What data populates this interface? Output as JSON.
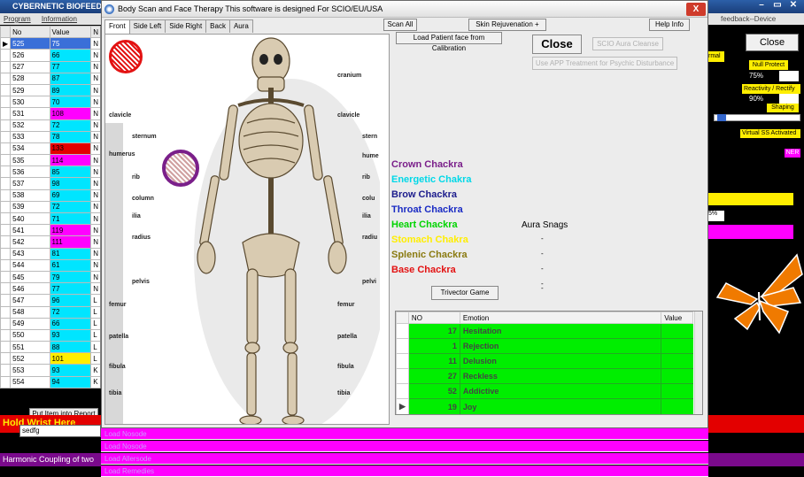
{
  "background_app": {
    "title": "CYBERNETIC BIOFEEDBA",
    "menu": [
      "Program",
      "Information",
      "A"
    ],
    "table_headers": [
      "No",
      "Value",
      "N"
    ],
    "rows": [
      {
        "no": "525",
        "value": "75",
        "flag": "N",
        "color": "#3a6fd8",
        "sel": true
      },
      {
        "no": "526",
        "value": "66",
        "flag": "N",
        "color": "#00e5ff"
      },
      {
        "no": "527",
        "value": "77",
        "flag": "N",
        "color": "#00e5ff"
      },
      {
        "no": "528",
        "value": "87",
        "flag": "N",
        "color": "#00e5ff"
      },
      {
        "no": "529",
        "value": "89",
        "flag": "N",
        "color": "#00e5ff"
      },
      {
        "no": "530",
        "value": "70",
        "flag": "N",
        "color": "#00e5ff"
      },
      {
        "no": "531",
        "value": "108",
        "flag": "N",
        "color": "#ff00ff"
      },
      {
        "no": "532",
        "value": "72",
        "flag": "N",
        "color": "#00e5ff"
      },
      {
        "no": "533",
        "value": "78",
        "flag": "N",
        "color": "#00e5ff"
      },
      {
        "no": "534",
        "value": "133",
        "flag": "N",
        "color": "#e30000"
      },
      {
        "no": "535",
        "value": "114",
        "flag": "N",
        "color": "#ff00ff"
      },
      {
        "no": "536",
        "value": "85",
        "flag": "N",
        "color": "#00e5ff"
      },
      {
        "no": "537",
        "value": "98",
        "flag": "N",
        "color": "#00e5ff"
      },
      {
        "no": "538",
        "value": "69",
        "flag": "N",
        "color": "#00e5ff"
      },
      {
        "no": "539",
        "value": "72",
        "flag": "N",
        "color": "#00e5ff"
      },
      {
        "no": "540",
        "value": "71",
        "flag": "N",
        "color": "#00e5ff"
      },
      {
        "no": "541",
        "value": "119",
        "flag": "N",
        "color": "#ff00ff"
      },
      {
        "no": "542",
        "value": "111",
        "flag": "N",
        "color": "#ff00ff"
      },
      {
        "no": "543",
        "value": "81",
        "flag": "N",
        "color": "#00e5ff"
      },
      {
        "no": "544",
        "value": "61",
        "flag": "N",
        "color": "#00e5ff"
      },
      {
        "no": "545",
        "value": "79",
        "flag": "N",
        "color": "#00e5ff"
      },
      {
        "no": "546",
        "value": "77",
        "flag": "N",
        "color": "#00e5ff"
      },
      {
        "no": "547",
        "value": "96",
        "flag": "L",
        "color": "#00e5ff"
      },
      {
        "no": "548",
        "value": "72",
        "flag": "L",
        "color": "#00e5ff"
      },
      {
        "no": "549",
        "value": "66",
        "flag": "L",
        "color": "#00e5ff"
      },
      {
        "no": "550",
        "value": "93",
        "flag": "L",
        "color": "#00e5ff"
      },
      {
        "no": "551",
        "value": "88",
        "flag": "L",
        "color": "#00e5ff"
      },
      {
        "no": "552",
        "value": "101",
        "flag": "L",
        "color": "#ffee00"
      },
      {
        "no": "553",
        "value": "93",
        "flag": "K",
        "color": "#00e5ff"
      },
      {
        "no": "554",
        "value": "94",
        "flag": "K",
        "color": "#00e5ff"
      },
      {
        "no": "555",
        "value": "131",
        "flag": "K",
        "color": "#e30000"
      }
    ],
    "put_item_button": "Put Item into Report",
    "hold_banner": "Hold Wrist Here",
    "small_input": "sedfg",
    "harmonic": "Harmonic Coupling of two",
    "right_title": "feedback--Device",
    "right_close": "Close",
    "normal_label": "rmal",
    "null_protect": "Null Protect",
    "pct_75": "75%",
    "reactivity": "Reactivity / Rectify",
    "pct_90": "90%",
    "shaping": "Shaping",
    "virtual": "Virtual SS Activated",
    "ner": "NER",
    "dropdown": "5%"
  },
  "bottom_bars": [
    "Load Nosode",
    "Load Nosode",
    "Load Allersode",
    "Load Remedies"
  ],
  "dialog": {
    "title": "Body Scan and Face Therapy  This software is designed For SCIO/EU/USA",
    "close_x": "X",
    "tabs": [
      "Front",
      "Side Left",
      "Side Right",
      "Back",
      "Aura"
    ],
    "scan_all": "Scan All",
    "skin_select": "Skin Rejuvenation +",
    "help_info": "Help Info",
    "load_patient": "Load Patient face from Calibration",
    "close": "Close",
    "scio_aura": "SCIO Aura Cleanse",
    "app_treatment": "Use APP Treatment for Psychic Disturbance",
    "trivector": "Trivector Game",
    "aura_snags": "Aura Snags",
    "snag_dashes": [
      "-",
      "-",
      "-",
      "-",
      "-"
    ]
  },
  "bone_labels": {
    "left": [
      "clavicle",
      "sternum",
      "humerus",
      "rib",
      "column",
      "ilia",
      "radius",
      "pelvis",
      "femur",
      "patella",
      "fibula",
      "tibia"
    ],
    "right": [
      "cranium",
      "clavicle",
      "stern",
      "hume",
      "rib",
      "colu",
      "ilia",
      "radiu",
      "pelvi",
      "femur",
      "patella",
      "fibula",
      "tibia"
    ]
  },
  "chakras": [
    {
      "label": "Crown Chackra",
      "color": "#7a1f8a"
    },
    {
      "label": "Energetic Chakra",
      "color": "#00d8e8"
    },
    {
      "label": "Brow Chackra",
      "color": "#1c1c8c"
    },
    {
      "label": "Throat Chackra",
      "color": "#1a2bc4"
    },
    {
      "label": "Heart Chackra",
      "color": "#00d400"
    },
    {
      "label": "Stomach Chakra",
      "color": "#ffee00"
    },
    {
      "label": "Splenic Chackra",
      "color": "#8a7a10"
    },
    {
      "label": "Base Chackra",
      "color": "#e31212"
    }
  ],
  "emotion_grid": {
    "headers": [
      "NO",
      "Emotion",
      "Value"
    ],
    "rows": [
      {
        "no": "17",
        "emotion": "Hesitation",
        "value": ""
      },
      {
        "no": "1",
        "emotion": "Rejection",
        "value": ""
      },
      {
        "no": "11",
        "emotion": "Delusion",
        "value": ""
      },
      {
        "no": "27",
        "emotion": "Reckless",
        "value": ""
      },
      {
        "no": "52",
        "emotion": "Addictive",
        "value": ""
      },
      {
        "no": "19",
        "emotion": "Joy",
        "value": ""
      }
    ]
  }
}
